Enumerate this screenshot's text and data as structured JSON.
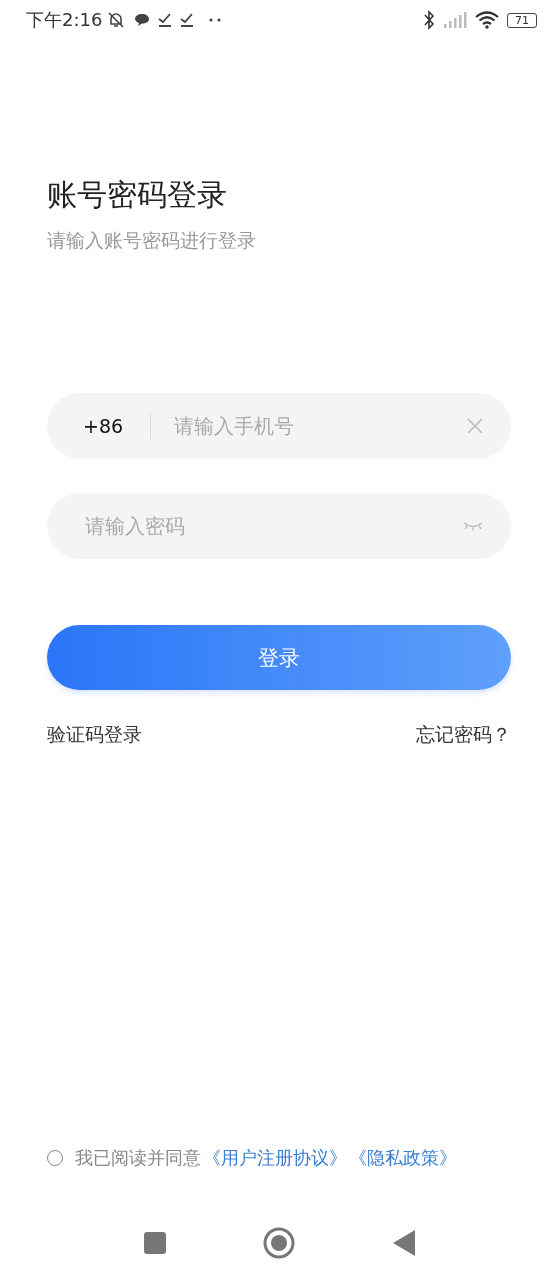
{
  "status_bar": {
    "time": "下午2:16",
    "battery": "71"
  },
  "header": {
    "title": "账号密码登录",
    "subtitle": "请输入账号密码进行登录"
  },
  "phone_field": {
    "country_code": "+86",
    "placeholder": "请输入手机号"
  },
  "password_field": {
    "placeholder": "请输入密码"
  },
  "login_button": "登录",
  "links": [
    {
      "label": "验证码登录"
    },
    {
      "label": "忘记密码？"
    }
  ],
  "agreement": {
    "checked": false,
    "text": "我已阅读并同意",
    "links": [
      "《用户注册协议》",
      "《隐私政策》"
    ]
  }
}
